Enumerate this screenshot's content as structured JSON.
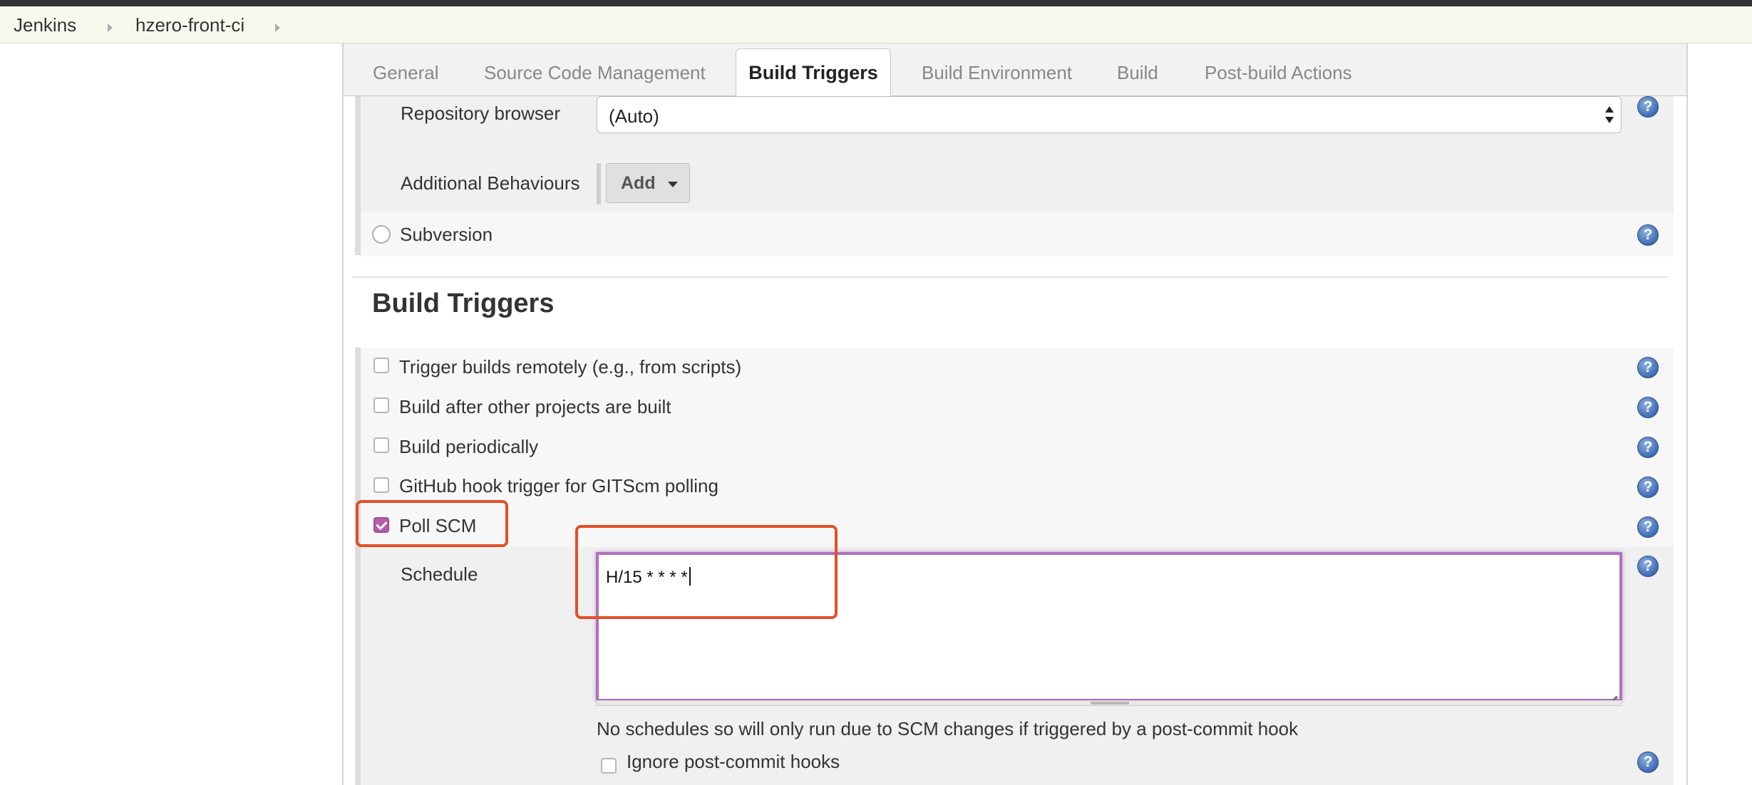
{
  "breadcrumb": {
    "items": [
      "Jenkins",
      "hzero-front-ci"
    ]
  },
  "tabs": {
    "items": [
      "General",
      "Source Code Management",
      "Build Triggers",
      "Build Environment",
      "Build",
      "Post-build Actions"
    ],
    "active": "Build Triggers"
  },
  "scm": {
    "repository_browser_label": "Repository browser",
    "repository_browser_value": "(Auto)",
    "additional_behaviours_label": "Additional Behaviours",
    "add_label": "Add",
    "subversion_label": "Subversion"
  },
  "build_triggers": {
    "title": "Build Triggers",
    "options": [
      {
        "label": "Trigger builds remotely (e.g., from scripts)",
        "checked": false
      },
      {
        "label": "Build after other projects are built",
        "checked": false
      },
      {
        "label": "Build periodically",
        "checked": false
      },
      {
        "label": "GitHub hook trigger for GITScm polling",
        "checked": false
      },
      {
        "label": "Poll SCM",
        "checked": true
      }
    ],
    "schedule_label": "Schedule",
    "schedule_value": "H/15 * * * *",
    "schedule_note": "No schedules so will only run due to SCM changes if triggered by a post-commit hook",
    "ignore_hooks_label": "Ignore post-commit hooks"
  },
  "help_icon_glyph": "?",
  "colors": {
    "highlight": "#e1502a",
    "checkbox_checked": "#b35ea8",
    "focus_border": "#b071bd"
  }
}
